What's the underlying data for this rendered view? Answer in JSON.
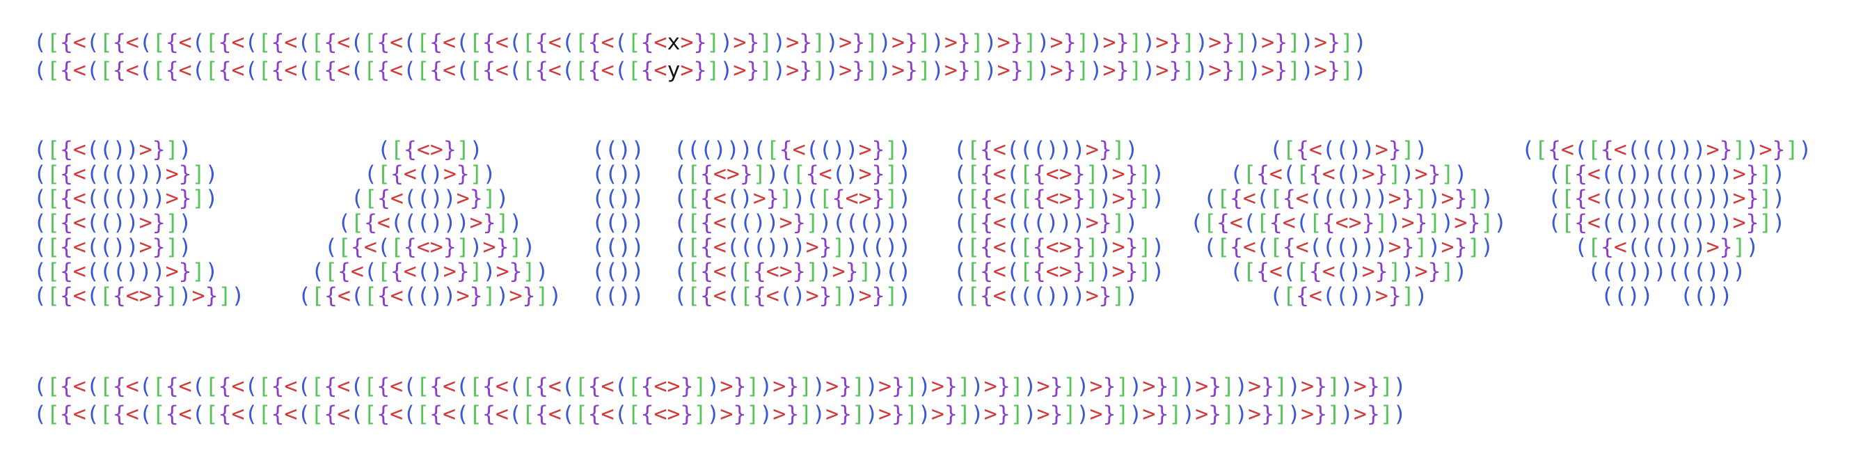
{
  "colors": {
    "paren": "#3b57d6",
    "bracket": "#55c55a",
    "brace": "#8a3fc9",
    "angle": "#d03a3a",
    "text": "#111111"
  },
  "top_lines": [
    "([{<([{<([{<([{<([{<([{<([{<([{<([{<([{<([{<([{<x>}])>}])>}])>}])>}])>}])>}])>}])>}])>}])>}])>}])>}])",
    "([{<([{<([{<([{<([{<([{<([{<([{<([{<([{<([{<([{<y>}])>}])>}])>}])>}])>}])>}])>}])>}])>}])>}])>}])>}])"
  ],
  "bottom_lines": [
    "([{<([{<([{<([{<([{<([{<([{<([{<([{<([{<([{<([{<>}])>}])>}])>}])>}])>}])>}])>}])>}])>}])>}])>}])>}])>}])",
    "([{<([{<([{<([{<([{<([{<([{<([{<([{<([{<([{<([{<>}])>}])>}])>}])>}])>}])>}])>}])>}])>}])>}])>}])>}])>}])"
  ],
  "columns": [
    {
      "lines": [
        "([{<(())>}])",
        "([{<((()))>}])",
        "([{<((()))>}])",
        "([{<(())>}])",
        "([{<(())>}])",
        "([{<((()))>}])",
        "([{<([{<>}])>}])"
      ]
    },
    {
      "lines": [
        "([{<>}])",
        "([{<()>}])",
        "([{<(())>}])",
        "([{<((()))>}])",
        "([{<([{<>}])>}])",
        "([{<([{<()>}])>}])",
        "([{<([{<(())>}])>}])"
      ]
    },
    {
      "lines": [
        "(())",
        "(())",
        "(())",
        "(())",
        "(())",
        "(())",
        "(())"
      ]
    },
    {
      "lines": [
        "((()))([{<(())>}])",
        "([{<>}])([{<()>}])",
        "([{<()>}])([{<>}])",
        "([{<(())>}])((()))",
        "([{<((()))>}])(())",
        "([{<([{<>}])>}])()",
        "([{<([{<()>}])>}])"
      ]
    },
    {
      "lines": [
        "([{<((()))>}])",
        "([{<([{<>}])>}])",
        "([{<([{<>}])>}])",
        "([{<((()))>}])",
        "([{<([{<>}])>}])",
        "([{<([{<>}])>}])",
        "([{<((()))>}])"
      ]
    },
    {
      "lines": [
        "([{<(())>}])",
        "([{<([{<()>}])>}])",
        "([{<([{<((()))>}])>}])",
        "([{<([{<([{<>}])>}])>}])",
        "([{<([{<((()))>}])>}])",
        "([{<([{<()>}])>}])",
        "([{<(())>}])"
      ]
    },
    {
      "lines": [
        "([{<([{<((()))>}])>}])",
        "([{<(())((()))>}])",
        "([{<(())((()))>}])",
        "([{<(())((()))>}])",
        "([{<((()))>}])",
        "((()))((()))",
        "(())  (())"
      ]
    }
  ]
}
